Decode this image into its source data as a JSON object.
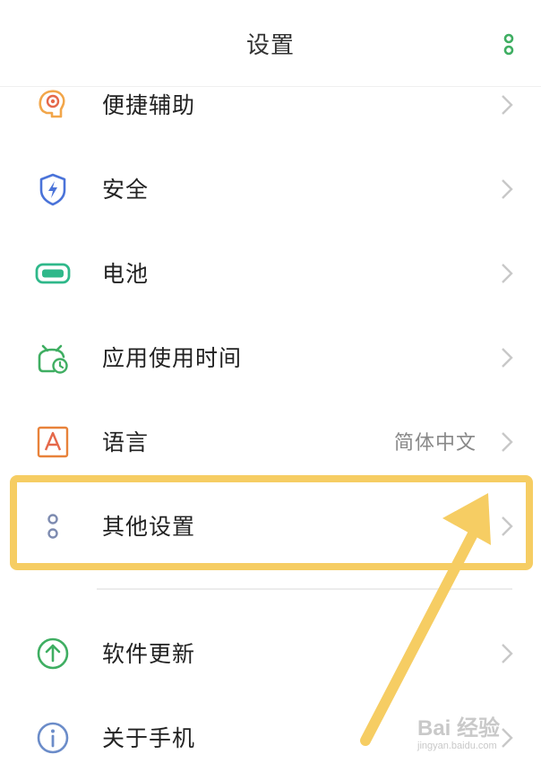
{
  "header": {
    "title": "设置",
    "more_icon": "more-vertical-icon"
  },
  "settings": [
    {
      "label": "便捷辅助",
      "value": "",
      "icon": "accessibility-head-icon",
      "color": "#f2a64a"
    },
    {
      "label": "安全",
      "value": "",
      "icon": "shield-bolt-icon",
      "color": "#4a73d9"
    },
    {
      "label": "电池",
      "value": "",
      "icon": "battery-icon",
      "color": "#2fb88a"
    },
    {
      "label": "应用使用时间",
      "value": "",
      "icon": "alarm-clock-icon",
      "color": "#3fae62"
    },
    {
      "label": "语言",
      "value": "简体中文",
      "icon": "language-a-icon",
      "color": "#e8823a"
    },
    {
      "label": "其他设置",
      "value": "",
      "icon": "dots-icon",
      "color": "#7d8bb0"
    },
    {
      "label": "软件更新",
      "value": "",
      "icon": "update-arrow-icon",
      "color": "#3fae62"
    },
    {
      "label": "关于手机",
      "value": "",
      "icon": "info-icon",
      "color": "#6b8cc9"
    }
  ],
  "watermark": {
    "brand": "Bai 经验",
    "url": "jingyan.baidu.com"
  },
  "colors": {
    "highlight": "#f6cd63",
    "accent_green": "#3fae62",
    "chevron": "#c8c8c8"
  }
}
